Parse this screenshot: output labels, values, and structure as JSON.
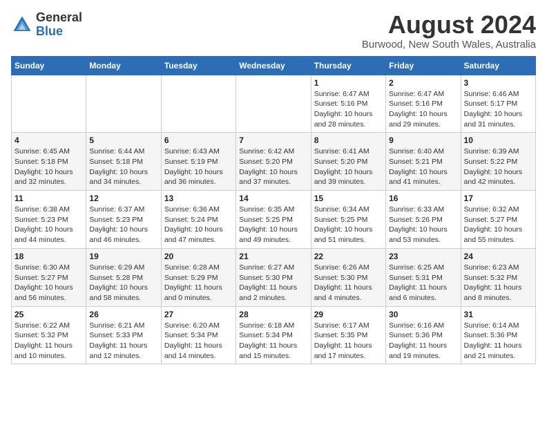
{
  "header": {
    "logo_general": "General",
    "logo_blue": "Blue",
    "month_year": "August 2024",
    "location": "Burwood, New South Wales, Australia"
  },
  "weekdays": [
    "Sunday",
    "Monday",
    "Tuesday",
    "Wednesday",
    "Thursday",
    "Friday",
    "Saturday"
  ],
  "weeks": [
    [
      {
        "day": "",
        "info": ""
      },
      {
        "day": "",
        "info": ""
      },
      {
        "day": "",
        "info": ""
      },
      {
        "day": "",
        "info": ""
      },
      {
        "day": "1",
        "info": "Sunrise: 6:47 AM\nSunset: 5:16 PM\nDaylight: 10 hours\nand 28 minutes."
      },
      {
        "day": "2",
        "info": "Sunrise: 6:47 AM\nSunset: 5:16 PM\nDaylight: 10 hours\nand 29 minutes."
      },
      {
        "day": "3",
        "info": "Sunrise: 6:46 AM\nSunset: 5:17 PM\nDaylight: 10 hours\nand 31 minutes."
      }
    ],
    [
      {
        "day": "4",
        "info": "Sunrise: 6:45 AM\nSunset: 5:18 PM\nDaylight: 10 hours\nand 32 minutes."
      },
      {
        "day": "5",
        "info": "Sunrise: 6:44 AM\nSunset: 5:18 PM\nDaylight: 10 hours\nand 34 minutes."
      },
      {
        "day": "6",
        "info": "Sunrise: 6:43 AM\nSunset: 5:19 PM\nDaylight: 10 hours\nand 36 minutes."
      },
      {
        "day": "7",
        "info": "Sunrise: 6:42 AM\nSunset: 5:20 PM\nDaylight: 10 hours\nand 37 minutes."
      },
      {
        "day": "8",
        "info": "Sunrise: 6:41 AM\nSunset: 5:20 PM\nDaylight: 10 hours\nand 39 minutes."
      },
      {
        "day": "9",
        "info": "Sunrise: 6:40 AM\nSunset: 5:21 PM\nDaylight: 10 hours\nand 41 minutes."
      },
      {
        "day": "10",
        "info": "Sunrise: 6:39 AM\nSunset: 5:22 PM\nDaylight: 10 hours\nand 42 minutes."
      }
    ],
    [
      {
        "day": "11",
        "info": "Sunrise: 6:38 AM\nSunset: 5:23 PM\nDaylight: 10 hours\nand 44 minutes."
      },
      {
        "day": "12",
        "info": "Sunrise: 6:37 AM\nSunset: 5:23 PM\nDaylight: 10 hours\nand 46 minutes."
      },
      {
        "day": "13",
        "info": "Sunrise: 6:36 AM\nSunset: 5:24 PM\nDaylight: 10 hours\nand 47 minutes."
      },
      {
        "day": "14",
        "info": "Sunrise: 6:35 AM\nSunset: 5:25 PM\nDaylight: 10 hours\nand 49 minutes."
      },
      {
        "day": "15",
        "info": "Sunrise: 6:34 AM\nSunset: 5:25 PM\nDaylight: 10 hours\nand 51 minutes."
      },
      {
        "day": "16",
        "info": "Sunrise: 6:33 AM\nSunset: 5:26 PM\nDaylight: 10 hours\nand 53 minutes."
      },
      {
        "day": "17",
        "info": "Sunrise: 6:32 AM\nSunset: 5:27 PM\nDaylight: 10 hours\nand 55 minutes."
      }
    ],
    [
      {
        "day": "18",
        "info": "Sunrise: 6:30 AM\nSunset: 5:27 PM\nDaylight: 10 hours\nand 56 minutes."
      },
      {
        "day": "19",
        "info": "Sunrise: 6:29 AM\nSunset: 5:28 PM\nDaylight: 10 hours\nand 58 minutes."
      },
      {
        "day": "20",
        "info": "Sunrise: 6:28 AM\nSunset: 5:29 PM\nDaylight: 11 hours\nand 0 minutes."
      },
      {
        "day": "21",
        "info": "Sunrise: 6:27 AM\nSunset: 5:30 PM\nDaylight: 11 hours\nand 2 minutes."
      },
      {
        "day": "22",
        "info": "Sunrise: 6:26 AM\nSunset: 5:30 PM\nDaylight: 11 hours\nand 4 minutes."
      },
      {
        "day": "23",
        "info": "Sunrise: 6:25 AM\nSunset: 5:31 PM\nDaylight: 11 hours\nand 6 minutes."
      },
      {
        "day": "24",
        "info": "Sunrise: 6:23 AM\nSunset: 5:32 PM\nDaylight: 11 hours\nand 8 minutes."
      }
    ],
    [
      {
        "day": "25",
        "info": "Sunrise: 6:22 AM\nSunset: 5:32 PM\nDaylight: 11 hours\nand 10 minutes."
      },
      {
        "day": "26",
        "info": "Sunrise: 6:21 AM\nSunset: 5:33 PM\nDaylight: 11 hours\nand 12 minutes."
      },
      {
        "day": "27",
        "info": "Sunrise: 6:20 AM\nSunset: 5:34 PM\nDaylight: 11 hours\nand 14 minutes."
      },
      {
        "day": "28",
        "info": "Sunrise: 6:18 AM\nSunset: 5:34 PM\nDaylight: 11 hours\nand 15 minutes."
      },
      {
        "day": "29",
        "info": "Sunrise: 6:17 AM\nSunset: 5:35 PM\nDaylight: 11 hours\nand 17 minutes."
      },
      {
        "day": "30",
        "info": "Sunrise: 6:16 AM\nSunset: 5:36 PM\nDaylight: 11 hours\nand 19 minutes."
      },
      {
        "day": "31",
        "info": "Sunrise: 6:14 AM\nSunset: 5:36 PM\nDaylight: 11 hours\nand 21 minutes."
      }
    ]
  ]
}
